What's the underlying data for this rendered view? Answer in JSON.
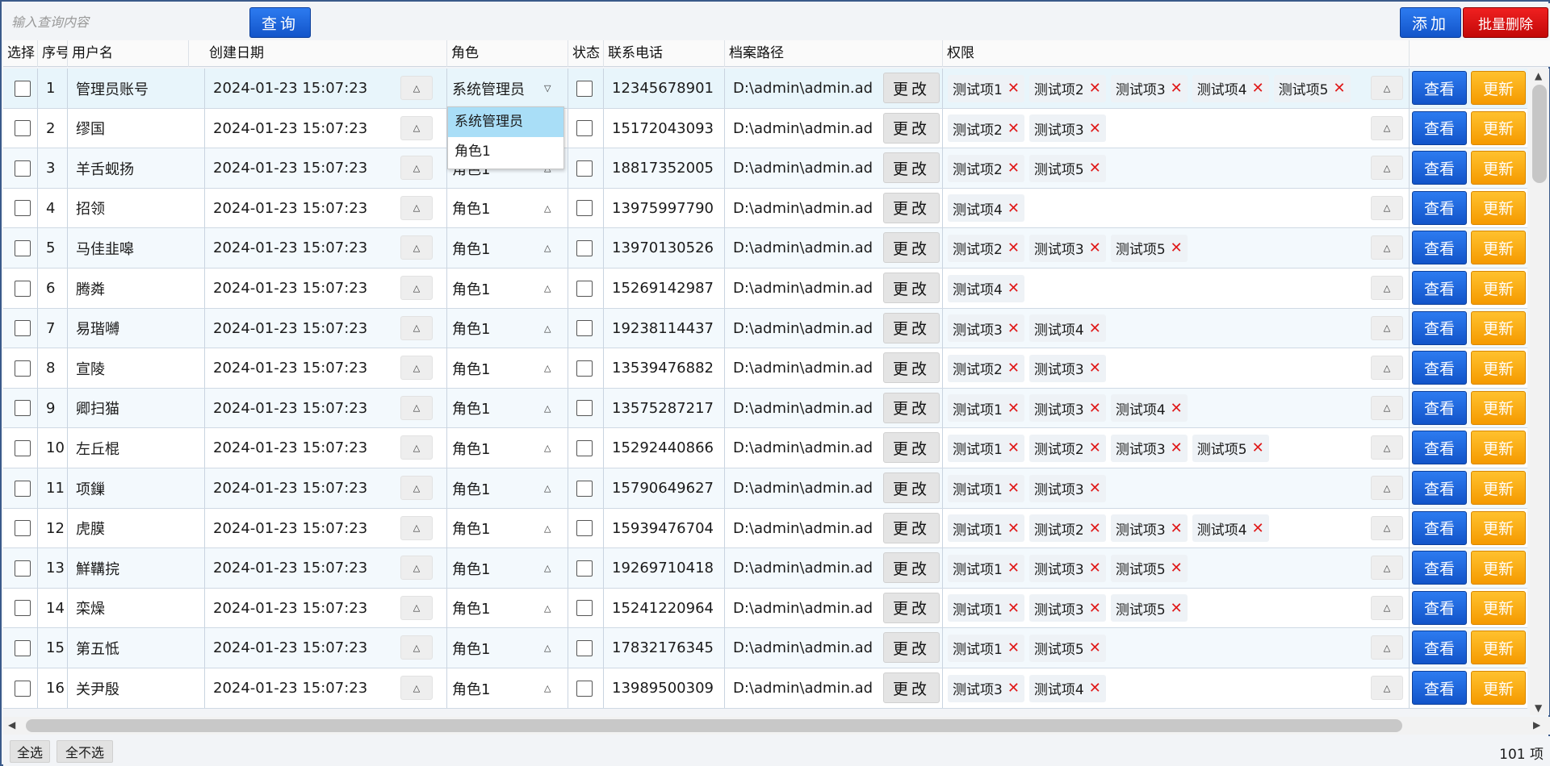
{
  "toolbar": {
    "search_placeholder": "输入查询内容",
    "query_label": "查询",
    "add_label": "添加",
    "batch_delete_label": "批量删除"
  },
  "columns": {
    "select": "选择",
    "index": "序号",
    "username": "用户名",
    "created": "创建日期",
    "role": "角色",
    "status": "状态",
    "phone": "联系电话",
    "path": "档案路径",
    "permissions": "权限"
  },
  "actions": {
    "change": "更改",
    "view": "查看",
    "update": "更新"
  },
  "role_dropdown": {
    "options": [
      "系统管理员",
      "角色1"
    ],
    "selected": "系统管理员"
  },
  "rows": [
    {
      "index": "1",
      "username": "管理员账号",
      "created": "2024-01-23 15:07:23",
      "role": "系统管理员",
      "phone": "12345678901",
      "path": "D:\\admin\\admin.ad",
      "perms": [
        "测试项1",
        "测试项2",
        "测试项3",
        "测试项4",
        "测试项5"
      ]
    },
    {
      "index": "2",
      "username": "缪国",
      "created": "2024-01-23 15:07:23",
      "role": "角色1",
      "phone": "15172043093",
      "path": "D:\\admin\\admin.ad",
      "perms": [
        "测试项2",
        "测试项3"
      ]
    },
    {
      "index": "3",
      "username": "羊舌蚬扬",
      "created": "2024-01-23 15:07:23",
      "role": "角色1",
      "phone": "18817352005",
      "path": "D:\\admin\\admin.ad",
      "perms": [
        "测试项2",
        "测试项5"
      ]
    },
    {
      "index": "4",
      "username": "招领",
      "created": "2024-01-23 15:07:23",
      "role": "角色1",
      "phone": "13975997790",
      "path": "D:\\admin\\admin.ad",
      "perms": [
        "测试项4"
      ]
    },
    {
      "index": "5",
      "username": "马佳韭嗥",
      "created": "2024-01-23 15:07:23",
      "role": "角色1",
      "phone": "13970130526",
      "path": "D:\\admin\\admin.ad",
      "perms": [
        "测试项2",
        "测试项3",
        "测试项5"
      ]
    },
    {
      "index": "6",
      "username": "腾粦",
      "created": "2024-01-23 15:07:23",
      "role": "角色1",
      "phone": "15269142987",
      "path": "D:\\admin\\admin.ad",
      "perms": [
        "测试项4"
      ]
    },
    {
      "index": "7",
      "username": "易瑎嚩",
      "created": "2024-01-23 15:07:23",
      "role": "角色1",
      "phone": "19238114437",
      "path": "D:\\admin\\admin.ad",
      "perms": [
        "测试项3",
        "测试项4"
      ]
    },
    {
      "index": "8",
      "username": "宣陵",
      "created": "2024-01-23 15:07:23",
      "role": "角色1",
      "phone": "13539476882",
      "path": "D:\\admin\\admin.ad",
      "perms": [
        "测试项2",
        "测试项3"
      ]
    },
    {
      "index": "9",
      "username": "卿扫猫",
      "created": "2024-01-23 15:07:23",
      "role": "角色1",
      "phone": "13575287217",
      "path": "D:\\admin\\admin.ad",
      "perms": [
        "测试项1",
        "测试项3",
        "测试项4"
      ]
    },
    {
      "index": "10",
      "username": "左丘棍",
      "created": "2024-01-23 15:07:23",
      "role": "角色1",
      "phone": "15292440866",
      "path": "D:\\admin\\admin.ad",
      "perms": [
        "测试项1",
        "测试项2",
        "测试项3",
        "测试项5"
      ]
    },
    {
      "index": "11",
      "username": "项鏁",
      "created": "2024-01-23 15:07:23",
      "role": "角色1",
      "phone": "15790649627",
      "path": "D:\\admin\\admin.ad",
      "perms": [
        "测试项1",
        "测试项3"
      ]
    },
    {
      "index": "12",
      "username": "虎膜",
      "created": "2024-01-23 15:07:23",
      "role": "角色1",
      "phone": "15939476704",
      "path": "D:\\admin\\admin.ad",
      "perms": [
        "测试项1",
        "测试项2",
        "测试项3",
        "测试项4"
      ]
    },
    {
      "index": "13",
      "username": "鮮鞲捖",
      "created": "2024-01-23 15:07:23",
      "role": "角色1",
      "phone": "19269710418",
      "path": "D:\\admin\\admin.ad",
      "perms": [
        "测试项1",
        "测试项3",
        "测试项5"
      ]
    },
    {
      "index": "14",
      "username": "栾燥",
      "created": "2024-01-23 15:07:23",
      "role": "角色1",
      "phone": "15241220964",
      "path": "D:\\admin\\admin.ad",
      "perms": [
        "测试项1",
        "测试项3",
        "测试项5"
      ]
    },
    {
      "index": "15",
      "username": "第五怟",
      "created": "2024-01-23 15:07:23",
      "role": "角色1",
      "phone": "17832176345",
      "path": "D:\\admin\\admin.ad",
      "perms": [
        "测试项1",
        "测试项5"
      ]
    },
    {
      "index": "16",
      "username": "关尹殷",
      "created": "2024-01-23 15:07:23",
      "role": "角色1",
      "phone": "13989500309",
      "path": "D:\\admin\\admin.ad",
      "perms": [
        "测试项3",
        "测试项4"
      ]
    }
  ],
  "footer": {
    "select_all": "全选",
    "select_none": "全不选",
    "count": "101 项"
  },
  "colors": {
    "accent_blue": "#1e66e0",
    "danger_red": "#d50d0d",
    "update_orange": "#f7a800",
    "tag_x_red": "#e01818"
  }
}
